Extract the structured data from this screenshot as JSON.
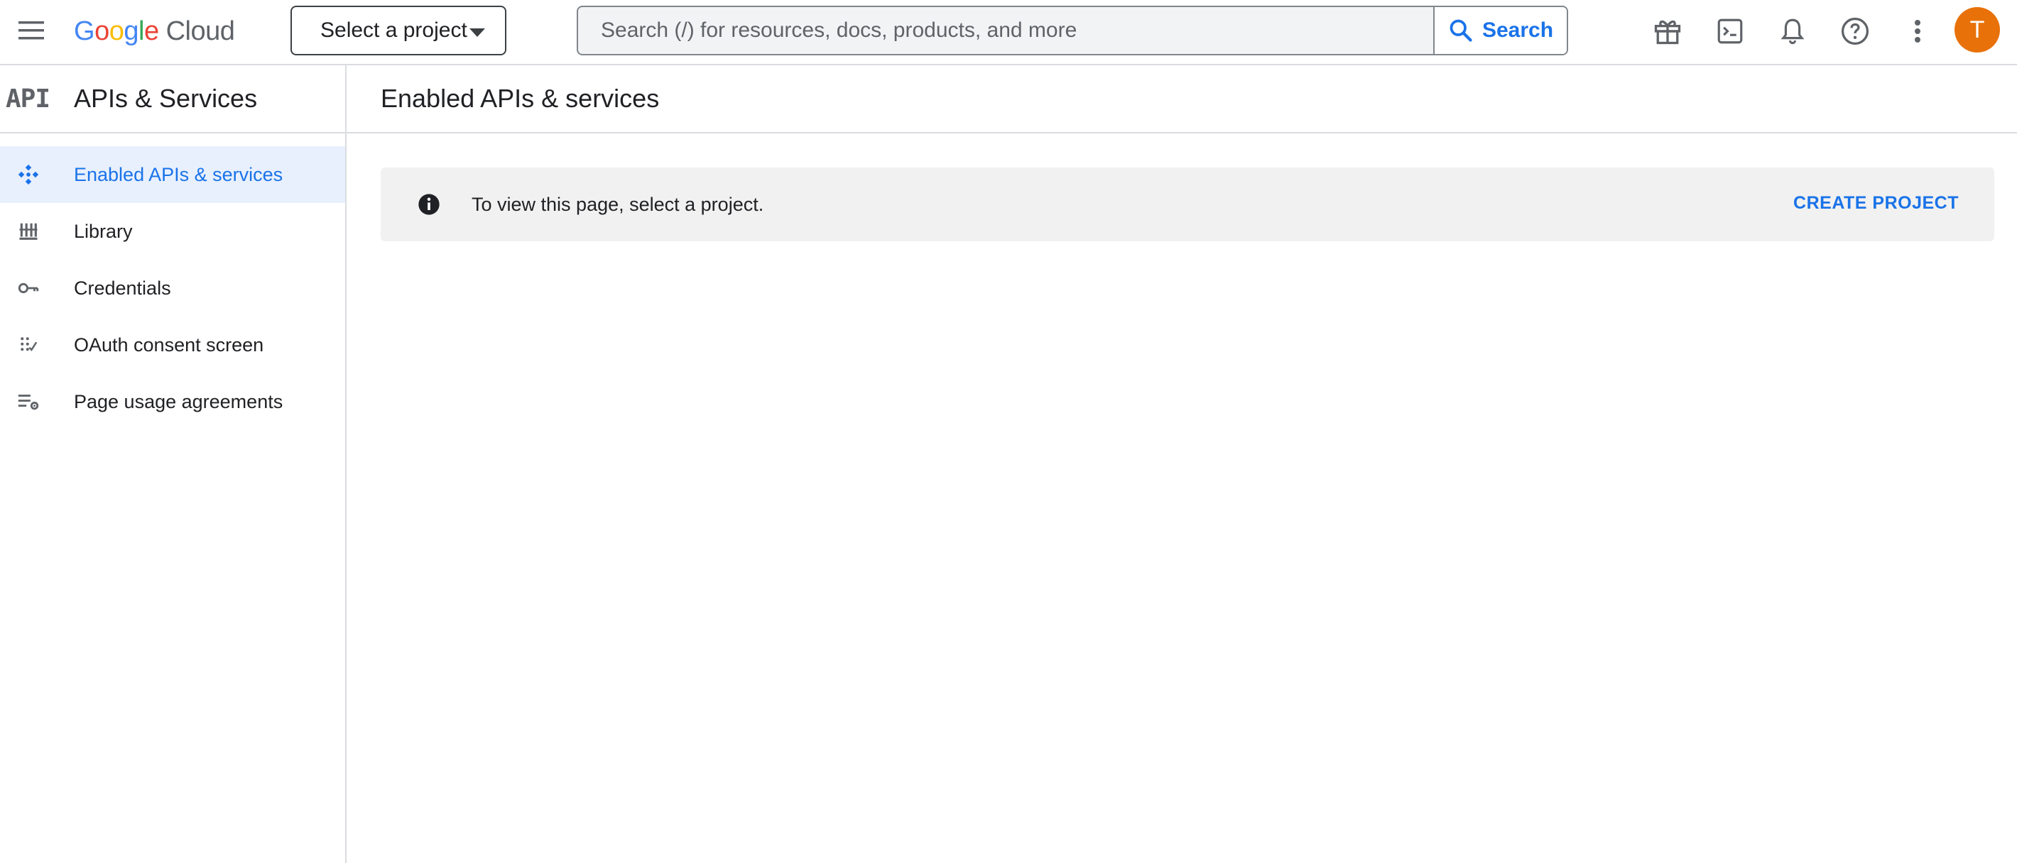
{
  "topbar": {
    "logo": {
      "google": "Google",
      "cloud": "Cloud"
    },
    "project_selector": "Select a project",
    "search": {
      "placeholder": "Search (/) for resources, docs, products, and more",
      "value": "",
      "button_label": "Search"
    },
    "icons": [
      "gift-icon",
      "terminal-icon",
      "bell-icon",
      "help-icon",
      "more-vert-icon"
    ],
    "avatar_initial": "T",
    "avatar_color": "#e8710a"
  },
  "sidebar": {
    "logo_text": "API",
    "title": "APIs & Services",
    "items": [
      {
        "label": "Enabled APIs & services",
        "icon": "enabled-apis-icon",
        "active": true
      },
      {
        "label": "Library",
        "icon": "library-icon",
        "active": false
      },
      {
        "label": "Credentials",
        "icon": "key-icon",
        "active": false
      },
      {
        "label": "OAuth consent screen",
        "icon": "oauth-icon",
        "active": false
      },
      {
        "label": "Page usage agreements",
        "icon": "settings-list-icon",
        "active": false
      }
    ]
  },
  "main": {
    "title": "Enabled APIs & services",
    "banner": {
      "message": "To view this page, select a project.",
      "action": "CREATE PROJECT"
    }
  },
  "colors": {
    "accent": "#1a73e8",
    "active_bg": "#e8f0fe",
    "banner_bg": "#f1f1f1",
    "divider": "#dadce0"
  }
}
